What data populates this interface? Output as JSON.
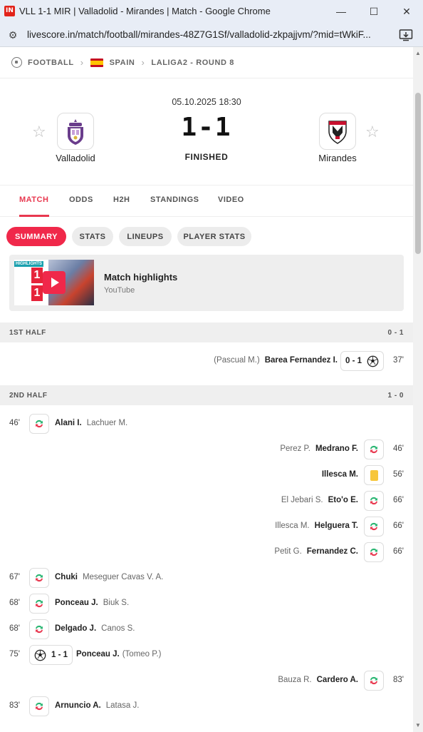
{
  "window": {
    "title": "VLL 1-1 MIR | Valladolid - Mirandes | Match - Google Chrome",
    "app_logo": "IN",
    "url": "livescore.in/match/football/mirandes-48Z7G1Sf/valladolid-zkpajjvm/?mid=tWkiF..."
  },
  "breadcrumb": {
    "sport": "FOOTBALL",
    "country": "SPAIN",
    "league": "LALIGA2 - ROUND 8"
  },
  "match": {
    "date": "05.10.2025 18:30",
    "score": "1-1",
    "status": "FINISHED",
    "home_team": "Valladolid",
    "away_team": "Mirandes"
  },
  "tabs": [
    "MATCH",
    "ODDS",
    "H2H",
    "STANDINGS",
    "VIDEO"
  ],
  "subtabs": [
    "SUMMARY",
    "STATS",
    "LINEUPS",
    "PLAYER STATS"
  ],
  "highlights": {
    "title": "Match highlights",
    "source": "YouTube",
    "tag": "HIGHLIGHTS",
    "home_score": "1",
    "away_score": "1"
  },
  "first_half": {
    "label": "1ST HALF",
    "score": "0 - 1",
    "events": [
      {
        "minute": "37'",
        "player": "Barea Fernandez I.",
        "assist": "(Pascual M.)",
        "score": "0 - 1"
      }
    ]
  },
  "second_half": {
    "label": "2ND HALF",
    "score": "1 - 0",
    "events": [
      {
        "minute": "46'",
        "player": "Alani I.",
        "secondary": "Lachuer M."
      },
      {
        "minute": "46'",
        "player": "Medrano F.",
        "secondary": "Perez P."
      },
      {
        "minute": "56'",
        "player": "Illesca M."
      },
      {
        "minute": "66'",
        "player": "Eto'o E.",
        "secondary": "El Jebari S."
      },
      {
        "minute": "66'",
        "player": "Helguera T.",
        "secondary": "Illesca M."
      },
      {
        "minute": "66'",
        "player": "Fernandez C.",
        "secondary": "Petit G."
      },
      {
        "minute": "67'",
        "player": "Chuki",
        "secondary": "Meseguer Cavas V. A."
      },
      {
        "minute": "68'",
        "player": "Ponceau J.",
        "secondary": "Biuk S."
      },
      {
        "minute": "68'",
        "player": "Delgado J.",
        "secondary": "Canos S."
      },
      {
        "minute": "75'",
        "player": "Ponceau J.",
        "secondary": "(Tomeo P.)",
        "score": "1 - 1"
      },
      {
        "minute": "83'",
        "player": "Cardero A.",
        "secondary": "Bauza R."
      },
      {
        "minute": "83'",
        "player": "Arnuncio A.",
        "secondary": "Latasa J."
      }
    ]
  },
  "colors": {
    "accent": "#f0284a",
    "sub_green": "#2bb673",
    "sub_red": "#e8384f",
    "yellow_card": "#f7c63a"
  }
}
